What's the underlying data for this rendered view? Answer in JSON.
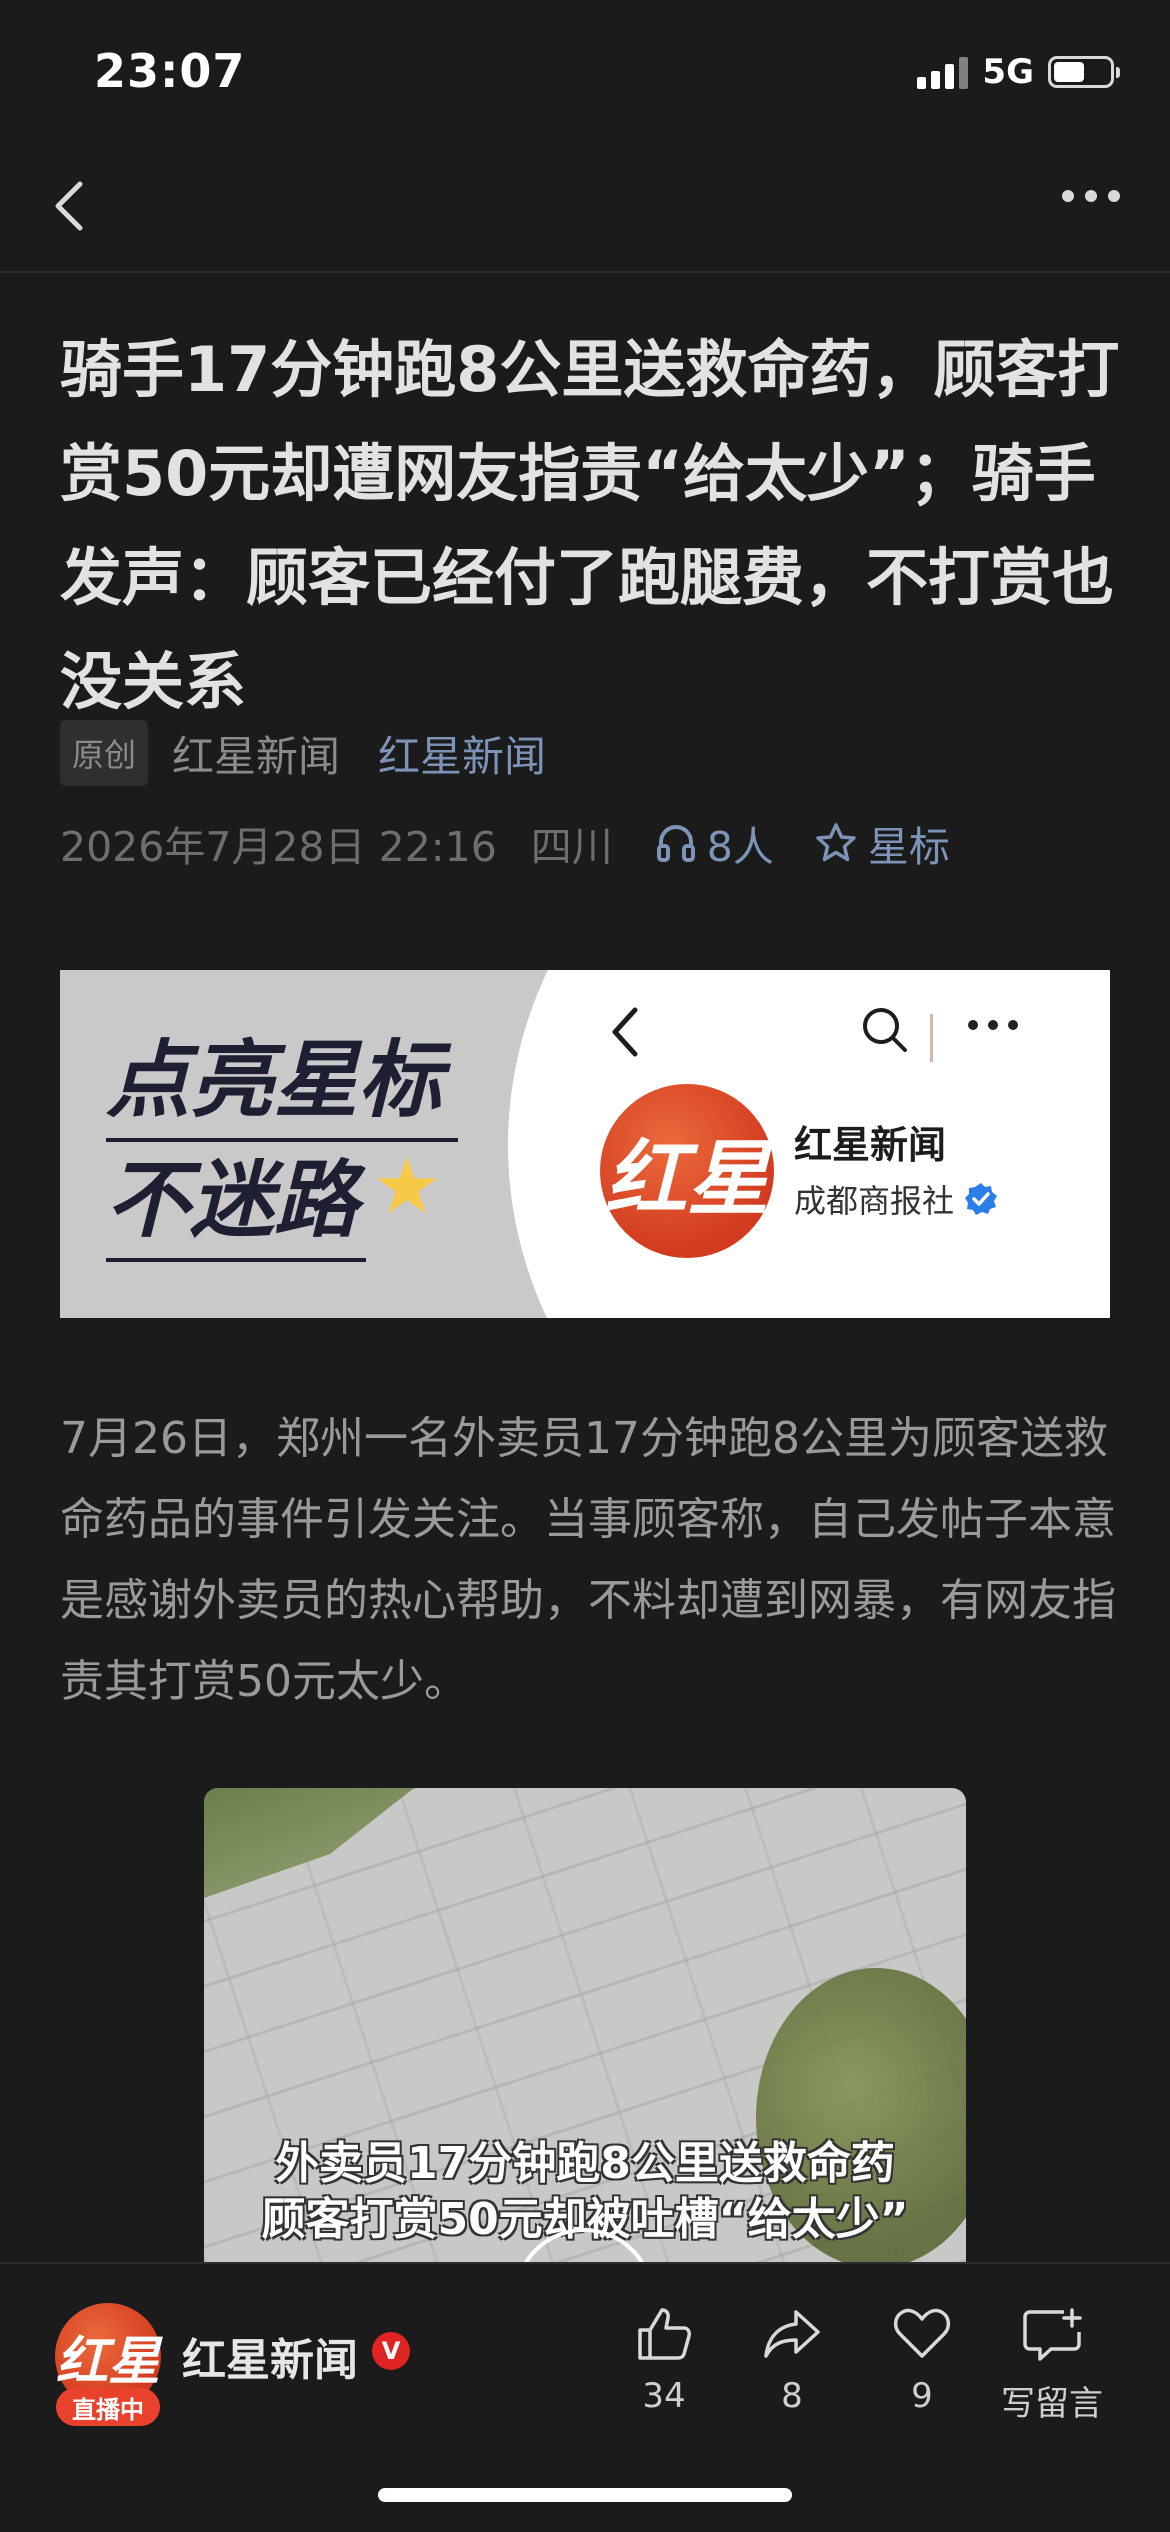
{
  "status_bar": {
    "time": "23:07",
    "network": "5G",
    "battery_percent": 55
  },
  "nav": {
    "back_icon": "chevron-left-icon",
    "more_icon": "ellipsis-icon"
  },
  "article": {
    "title": "骑手17分钟跑8公里送救命药，顾客打赏50元却遭网友指责“给太少”；骑手发声：顾客已经付了跑腿费，不打赏也没关系",
    "original_tag": "原创",
    "author": "红星新闻",
    "account": "红星新闻",
    "date": "2026年7月28日 22:16",
    "region": "四川",
    "listeners": "8人",
    "star_label": "星标",
    "body": "7月26日，郑州一名外卖员17分钟跑8公里为顾客送救命药品的事件引发关注。当事顾客称，自己发帖子本意是感谢外卖员的热心帮助，不料却遭到网暴，有网友指责其打赏50元太少。"
  },
  "banner": {
    "slogan_line1": "点亮星标",
    "slogan_line2": "不迷路",
    "star_glyph": "★",
    "logo_text": "红星",
    "account_name": "红星新闻",
    "org_name": "成都商报社"
  },
  "video": {
    "caption_line1": "外卖员17分钟跑8公里送救命药",
    "caption_line2": "顾客打赏50元却被吐槽“给太少”"
  },
  "bottom_bar": {
    "avatar_text": "红星",
    "live_label": "直播中",
    "account_name": "红星新闻",
    "verified_glyph": "V",
    "likes": "34",
    "shares": "8",
    "favorites": "9",
    "comment_label": "写留言"
  },
  "colors": {
    "background": "#1b1b1b",
    "link": "#7d93b8",
    "brand_red": "#d23b1f"
  }
}
